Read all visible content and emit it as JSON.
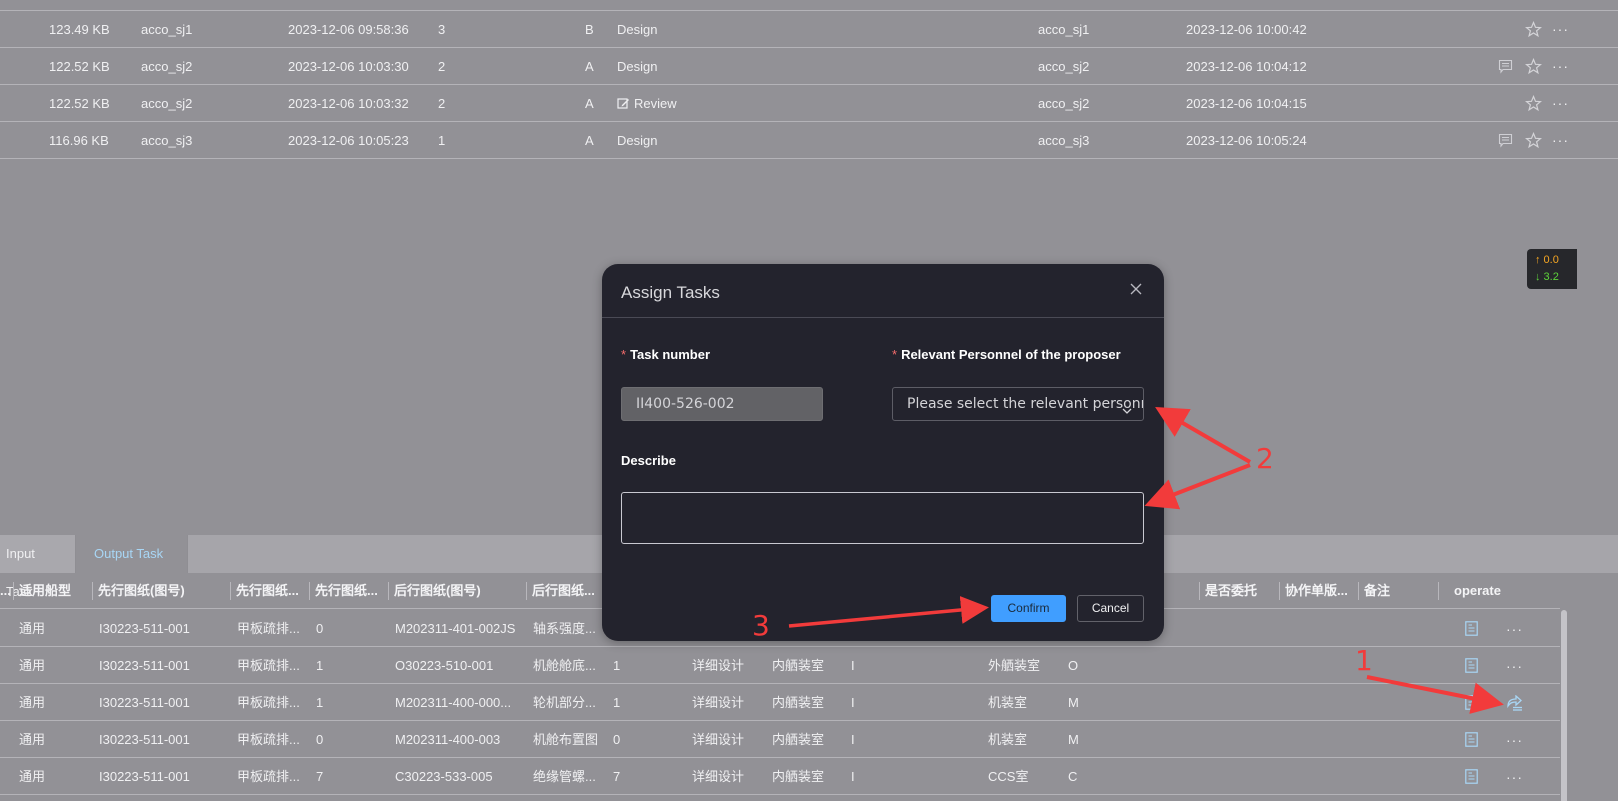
{
  "file_table": {
    "rows": [
      {
        "size": "123.49 KB",
        "uploader": "acco_sj1",
        "upload_time": "2023-12-06 09:58:36",
        "version": "3",
        "revision": "B",
        "stage": "Design",
        "stage_icon": "",
        "modifier": "acco_sj1",
        "modify_time": "2023-12-06 10:00:42",
        "has_comment": false
      },
      {
        "size": "122.52 KB",
        "uploader": "acco_sj2",
        "upload_time": "2023-12-06 10:03:30",
        "version": "2",
        "revision": "A",
        "stage": "Design",
        "stage_icon": "",
        "modifier": "acco_sj2",
        "modify_time": "2023-12-06 10:04:12",
        "has_comment": true
      },
      {
        "size": "122.52 KB",
        "uploader": "acco_sj2",
        "upload_time": "2023-12-06 10:03:32",
        "version": "2",
        "revision": "A",
        "stage": "Review",
        "stage_icon": "edit-icon",
        "modifier": "acco_sj2",
        "modify_time": "2023-12-06 10:04:15",
        "has_comment": false
      },
      {
        "size": "116.96 KB",
        "uploader": "acco_sj3",
        "upload_time": "2023-12-06 10:05:23",
        "version": "1",
        "revision": "A",
        "stage": "Design",
        "stage_icon": "",
        "modifier": "acco_sj3",
        "modify_time": "2023-12-06 10:05:24",
        "has_comment": true
      }
    ],
    "more_label": "···"
  },
  "speed_widget": {
    "upload": "↑ 0.0",
    "download": "↓ 3.2"
  },
  "tabs": [
    {
      "label": "Input Task",
      "active": false
    },
    {
      "label": "Output Task",
      "active": true
    }
  ],
  "task_table": {
    "headers": [
      "...",
      "适用船型",
      "先行图纸(图号)",
      "先行图纸...",
      "先行图纸...",
      "后行图纸(图号)",
      "后行图纸...",
      "是否委托",
      "协作单版...",
      "备注",
      "operate"
    ],
    "rows": [
      {
        "ship_type": "通用",
        "pre_drawing_no": "I30223-511-001",
        "pre_drawing_name": "甲板疏排...",
        "pre_version": "0",
        "post_drawing_no": "M202311-401-002JS",
        "post_drawing_name": "轴系强度...",
        "post_version": "",
        "design_stage": "",
        "dept": "",
        "dept_code": "",
        "collab_dept": "",
        "collab_code": "",
        "op": "more"
      },
      {
        "ship_type": "通用",
        "pre_drawing_no": "I30223-511-001",
        "pre_drawing_name": "甲板疏排...",
        "pre_version": "1",
        "post_drawing_no": "O30223-510-001",
        "post_drawing_name": "机舱舱底...",
        "post_version": "1",
        "design_stage": "详细设计",
        "dept": "内舾装室",
        "dept_code": "I",
        "collab_dept": "外舾装室",
        "collab_code": "O",
        "op": "more"
      },
      {
        "ship_type": "通用",
        "pre_drawing_no": "I30223-511-001",
        "pre_drawing_name": "甲板疏排...",
        "pre_version": "1",
        "post_drawing_no": "M202311-400-000...",
        "post_drawing_name": "轮机部分...",
        "post_version": "1",
        "design_stage": "详细设计",
        "dept": "内舾装室",
        "dept_code": "I",
        "collab_dept": "机装室",
        "collab_code": "M",
        "op": "assign"
      },
      {
        "ship_type": "通用",
        "pre_drawing_no": "I30223-511-001",
        "pre_drawing_name": "甲板疏排...",
        "pre_version": "0",
        "post_drawing_no": "M202311-400-003",
        "post_drawing_name": "机舱布置图",
        "post_version": "0",
        "design_stage": "详细设计",
        "dept": "内舾装室",
        "dept_code": "I",
        "collab_dept": "机装室",
        "collab_code": "M",
        "op": "more"
      },
      {
        "ship_type": "通用",
        "pre_drawing_no": "I30223-511-001",
        "pre_drawing_name": "甲板疏排...",
        "pre_version": "7",
        "post_drawing_no": "C30223-533-005",
        "post_drawing_name": "绝缘管螺...",
        "post_version": "7",
        "design_stage": "详细设计",
        "dept": "内舾装室",
        "dept_code": "I",
        "collab_dept": "CCS室",
        "collab_code": "C",
        "op": "more"
      }
    ],
    "more_label": "···"
  },
  "modal": {
    "title": "Assign Tasks",
    "task_number_label": "Task number",
    "task_number_value": "II400-526-002",
    "personnel_label": "Relevant Personnel of the proposer",
    "personnel_placeholder": "Please select the relevant personnel",
    "describe_label": "Describe",
    "describe_value": "",
    "required_mark": "*",
    "confirm_label": "Confirm",
    "cancel_label": "Cancel"
  },
  "annotations": {
    "step1": "1",
    "step2": "2",
    "step3": "3",
    "color": "#f23b3b"
  }
}
